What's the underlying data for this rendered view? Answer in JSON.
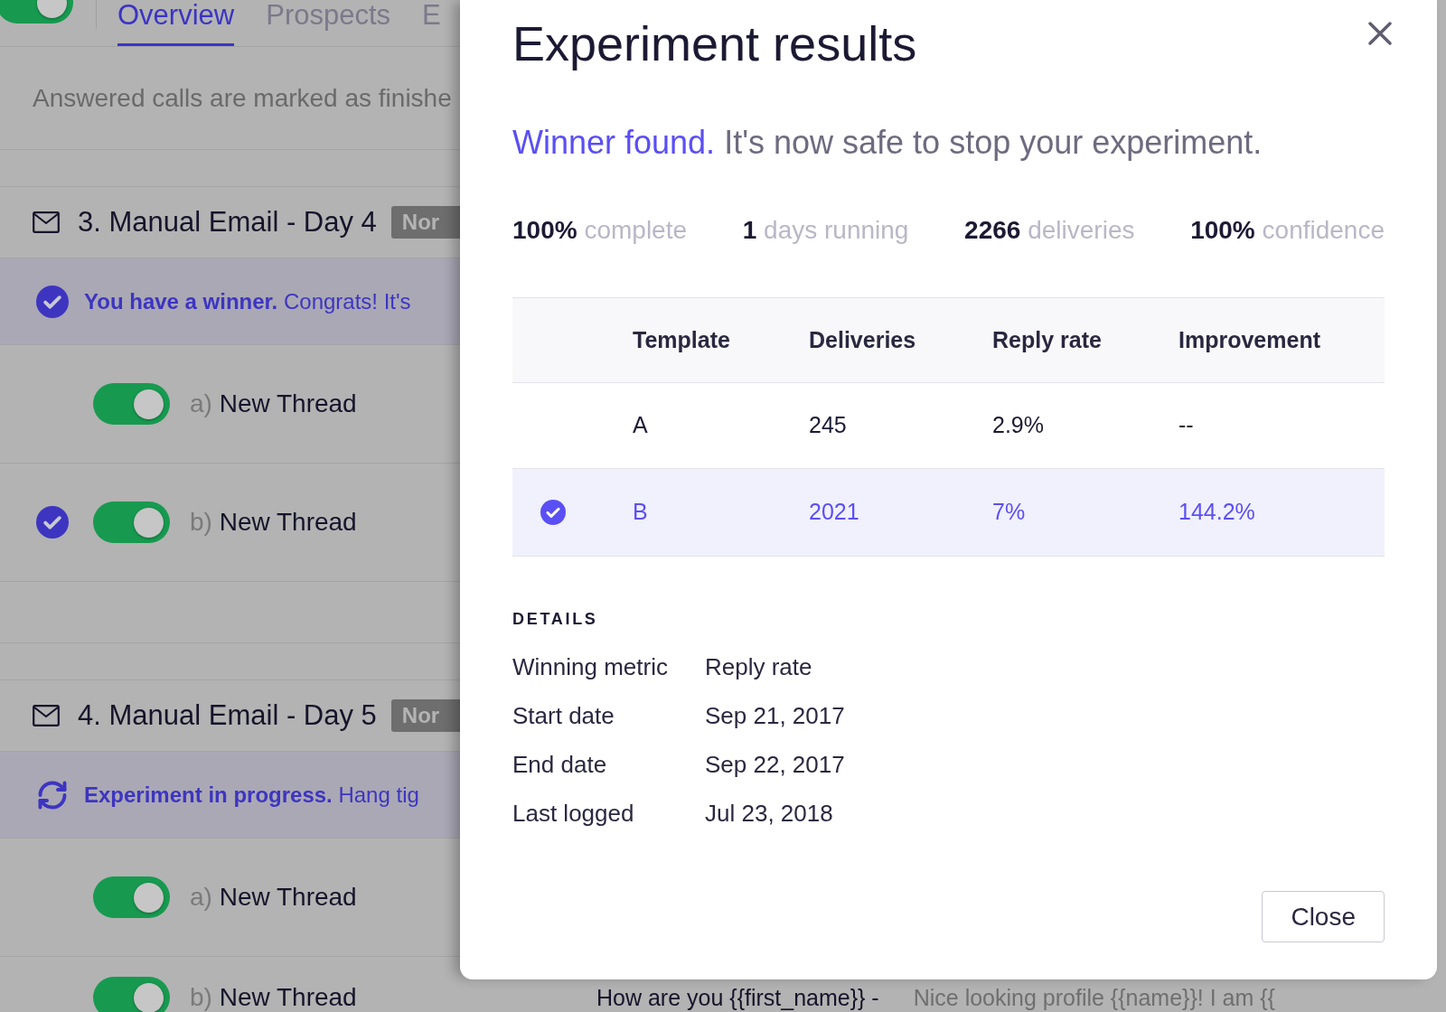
{
  "background": {
    "header_toggle": {
      "on": true
    },
    "tabs": [
      {
        "label": "Overview",
        "selected": true
      },
      {
        "label": "Prospects",
        "selected": false
      },
      {
        "label": "E",
        "selected": false
      }
    ],
    "notice": "Answered calls are marked as finishe",
    "steps": [
      {
        "title": "3. Manual Email - Day 4",
        "badge": "Nor",
        "banner": {
          "kind": "winner",
          "text": "**You have a winner.** Congrats! It's"
        },
        "variants": [
          {
            "letter": "a)",
            "name": "New Thread",
            "on": true,
            "winner": false
          },
          {
            "letter": "b)",
            "name": "New Thread",
            "on": true,
            "winner": true
          }
        ]
      },
      {
        "title": "4. Manual Email - Day 5",
        "badge": "Nor",
        "banner": {
          "kind": "progress",
          "text": "**Experiment in progress.** Hang tig"
        },
        "variants": [
          {
            "letter": "a)",
            "name": "New Thread",
            "on": true,
            "winner": false
          },
          {
            "letter": "b)",
            "name": "New Thread",
            "on": true,
            "winner": false,
            "subject": "How are you {{first_name}} -",
            "preview": "Nice looking profile {{name}}! I am {{"
          }
        ]
      }
    ]
  },
  "dialog": {
    "title": "Experiment results",
    "headline": "Winner found.",
    "message": "It's now safe to stop your experiment.",
    "stats": [
      {
        "value": "100%",
        "label": "complete"
      },
      {
        "value": "1",
        "label": "days running"
      },
      {
        "value": "2266",
        "label": "deliveries"
      },
      {
        "value": "100%",
        "label": "confidence"
      }
    ],
    "table": {
      "columns": [
        "Template",
        "Deliveries",
        "Reply rate",
        "Improvement"
      ],
      "rows": [
        {
          "selected": false,
          "cells": [
            "A",
            "245",
            "2.9%",
            "--"
          ]
        },
        {
          "selected": true,
          "cells": [
            "B",
            "2021",
            "7%",
            "144.2%"
          ]
        }
      ]
    },
    "details": {
      "title": "DETAILS",
      "rows": [
        {
          "label": "Winning metric",
          "value": "Reply rate"
        },
        {
          "label": "Start date",
          "value": "Sep 21, 2017"
        },
        {
          "label": "End date",
          "value": "Sep 22, 2017"
        },
        {
          "label": "Last logged",
          "value": "Jul 23, 2018"
        }
      ]
    },
    "buttons": [
      "Close"
    ]
  }
}
